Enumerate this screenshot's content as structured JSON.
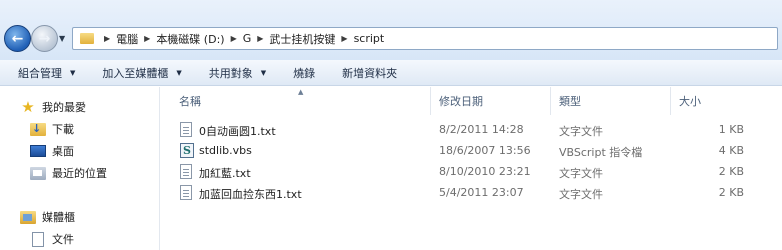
{
  "address_bar": {
    "crumbs": [
      "電腦",
      "本機磁碟 (D:)",
      "G",
      "武士挂机按键",
      "script"
    ]
  },
  "commands": [
    {
      "label": "組合管理",
      "has_menu": true
    },
    {
      "label": "加入至媒體櫃",
      "has_menu": true
    },
    {
      "label": "共用對象",
      "has_menu": true
    },
    {
      "label": "燒錄",
      "has_menu": false
    },
    {
      "label": "新增資料夾",
      "has_menu": false
    }
  ],
  "nav": {
    "favorites": "我的最愛",
    "downloads": "下載",
    "desktop": "桌面",
    "recent": "最近的位置",
    "libraries": "媒體櫃",
    "documents": "文件"
  },
  "columns": {
    "name": "名稱",
    "date": "修改日期",
    "type": "類型",
    "size": "大小"
  },
  "files": [
    {
      "name": "0自动画圆1.txt",
      "date": "8/2/2011 14:28",
      "type": "文字文件",
      "size": "1 KB",
      "icon": "text-file-icon"
    },
    {
      "name": "stdlib.vbs",
      "date": "18/6/2007 13:56",
      "type": "VBScript 指令檔",
      "size": "4 KB",
      "icon": "vbscript-file-icon"
    },
    {
      "name": "加紅藍.txt",
      "date": "8/10/2010 23:21",
      "type": "文字文件",
      "size": "2 KB",
      "icon": "text-file-icon"
    },
    {
      "name": "加蓝回血捡东西1.txt",
      "date": "5/4/2011 23:07",
      "type": "文字文件",
      "size": "2 KB",
      "icon": "text-file-icon"
    }
  ]
}
